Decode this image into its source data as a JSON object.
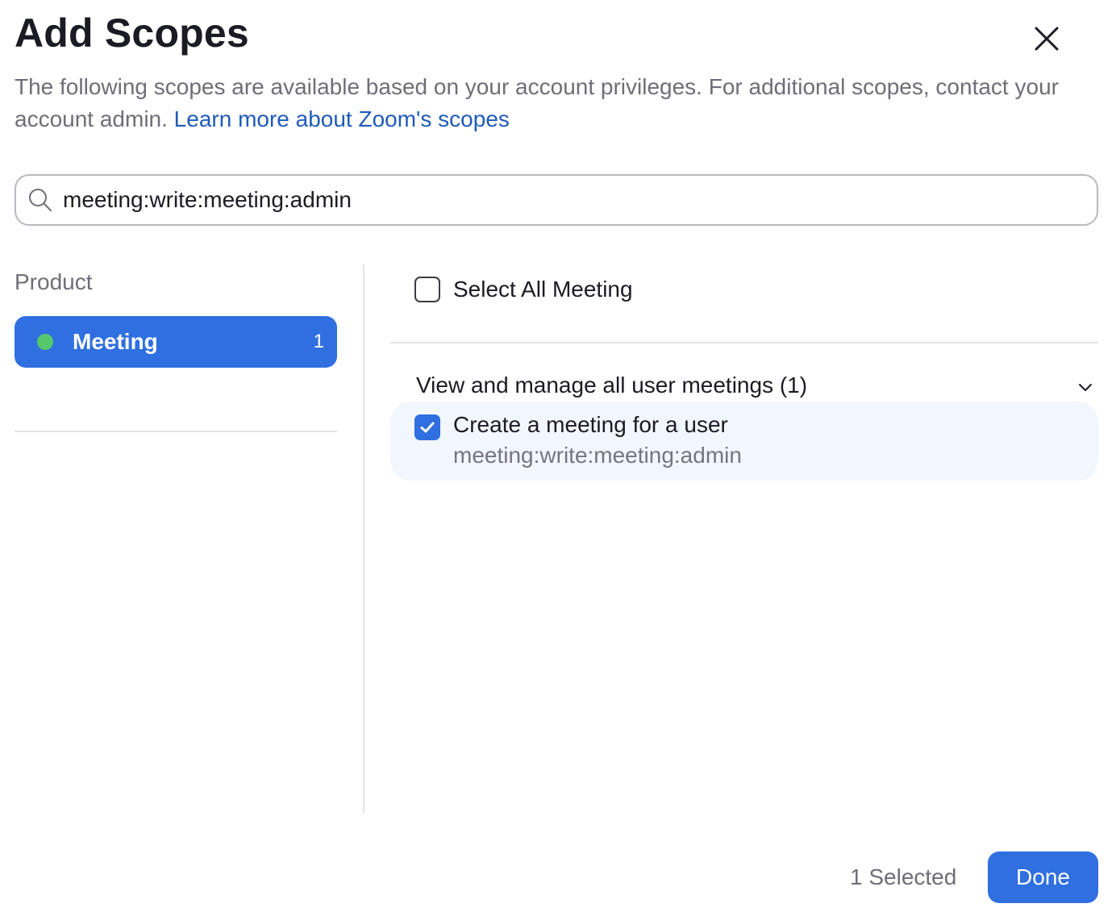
{
  "dialog": {
    "title": "Add Scopes",
    "description": "The following scopes are available based on your account privileges. For additional scopes, contact your account admin.",
    "learn_more_link": "Learn more about Zoom's scopes",
    "close_icon": "close-icon"
  },
  "search": {
    "value": "meeting:write:meeting:admin",
    "icon": "search-icon"
  },
  "products": {
    "label": "Product",
    "items": [
      {
        "name": "Meeting",
        "count": "1",
        "status_color": "#56c86b",
        "selected": true
      }
    ]
  },
  "scopes": {
    "select_all_label": "Select All Meeting",
    "select_all_checked": false,
    "groups": [
      {
        "title": "View and manage all user meetings (1)",
        "expanded": true,
        "items": [
          {
            "name": "Create a meeting for a user",
            "id": "meeting:write:meeting:admin",
            "checked": true
          }
        ]
      }
    ]
  },
  "footer": {
    "selected_text": "1 Selected",
    "done_label": "Done"
  },
  "colors": {
    "accent": "#2f6fe0",
    "link": "#1f5bb8",
    "card_background": "#f2f6fd"
  }
}
